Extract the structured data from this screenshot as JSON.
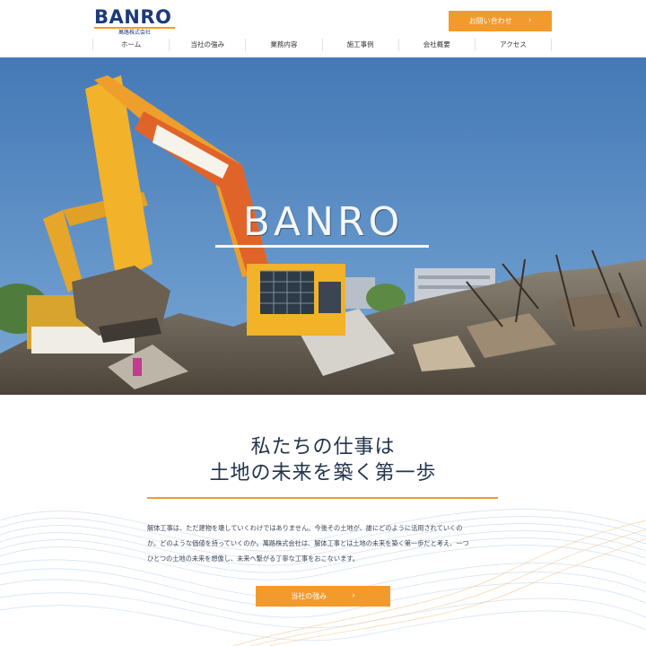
{
  "header": {
    "logo_text": "BANRO",
    "logo_subtext": "萬路株式会社",
    "contact_label": "お問い合わせ",
    "nav": [
      "ホーム",
      "当社の強み",
      "業務内容",
      "施工事例",
      "会社概要",
      "アクセス"
    ]
  },
  "hero": {
    "title": "BANRO",
    "image_subject": "excavators-on-demolition-rubble"
  },
  "main": {
    "heading_line1": "私たちの仕事は",
    "heading_line2": "土地の未来を築く第一歩",
    "body_lines": [
      "解体工事は、ただ建物を壊していくわけではありません。今後その土地が、誰にどのように活用されていくの",
      "か。どのような価値を持っていくのか。萬路株式会社は、解体工事とは土地の未来を築く第一歩だと考え、一つ",
      "ひとつの土地の未来を想像し、未来へ繋がる丁寧な工事をおこないます。"
    ],
    "cta_label": "当社の強み"
  },
  "colors": {
    "accent": "#f39a2d",
    "brand_navy": "#1c3a7a",
    "heading": "#22344d",
    "sky": "#4f86c0"
  },
  "icons": [
    "chevron-right-icon"
  ]
}
